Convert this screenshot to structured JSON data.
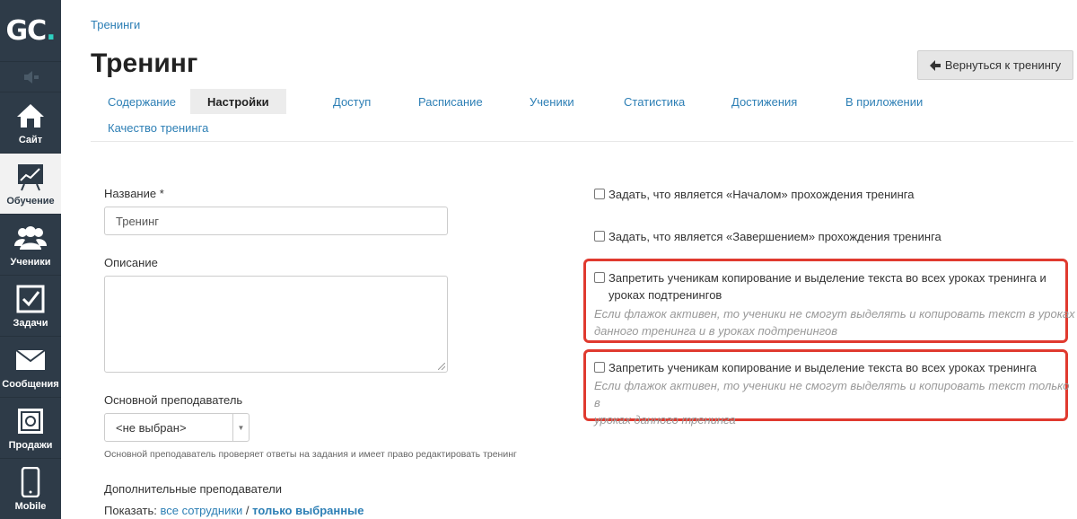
{
  "app": {
    "logo_text": "GC",
    "logo_dot": "."
  },
  "sidebar": {
    "items": [
      {
        "label": "Сайт",
        "icon": "home-icon"
      },
      {
        "label": "Обучение",
        "icon": "chart-board-icon",
        "active": true
      },
      {
        "label": "Ученики",
        "icon": "users-icon"
      },
      {
        "label": "Задачи",
        "icon": "checkbox-icon"
      },
      {
        "label": "Сообщения",
        "icon": "envelope-icon"
      },
      {
        "label": "Продажи",
        "icon": "safe-icon"
      },
      {
        "label": "Mobile",
        "icon": "phone-icon"
      }
    ]
  },
  "header": {
    "breadcrumb": "Тренинги",
    "title": "Тренинг",
    "back_button": "Вернуться к тренингу"
  },
  "tabs": [
    {
      "label": "Содержание"
    },
    {
      "label": "Настройки",
      "active": true
    },
    {
      "label": "Доступ"
    },
    {
      "label": "Расписание"
    },
    {
      "label": "Ученики"
    },
    {
      "label": "Статистика"
    },
    {
      "label": "Достижения"
    },
    {
      "label": "В приложении"
    },
    {
      "label": "Качество тренинга"
    }
  ],
  "form": {
    "name_label": "Название *",
    "name_value": "Тренинг",
    "description_label": "Описание",
    "teacher_label": "Основной преподаватель",
    "teacher_value": "<не выбран>",
    "teacher_hint": "Основной преподаватель проверяет ответы на задания и имеет право редактировать тренинг",
    "extra_teachers_label": "Дополнительные преподаватели",
    "show_label": "Показать:",
    "show_all": "все сотрудники",
    "show_sep": "/",
    "show_selected": "только выбранные"
  },
  "options": {
    "start": "Задать, что является «Началом» прохождения тренинга",
    "finish": "Задать, что является «Завершением» прохождения тренинга",
    "no_copy_sub_line1": "Запретить ученикам копирование и выделение текста во всех уроках тренинга и",
    "no_copy_sub_line2": "уроках подтренингов",
    "no_copy_sub_desc1": "Если флажок активен, то ученики не смогут выделять и копировать текст в уроках",
    "no_copy_sub_desc2": "данного тренинга и в уроках подтренингов",
    "no_copy": "Запретить ученикам копирование и выделение текста во всех уроках тренинга",
    "no_copy_desc1": "Если флажок активен, то ученики не смогут выделять и копировать текст только в",
    "no_copy_desc2": "уроках данного тренинга"
  },
  "colors": {
    "sidebar_bg": "#2e3b48",
    "link": "#2d7fb5",
    "highlight": "#e03a2f",
    "logo_accent": "#2ecfc0"
  }
}
